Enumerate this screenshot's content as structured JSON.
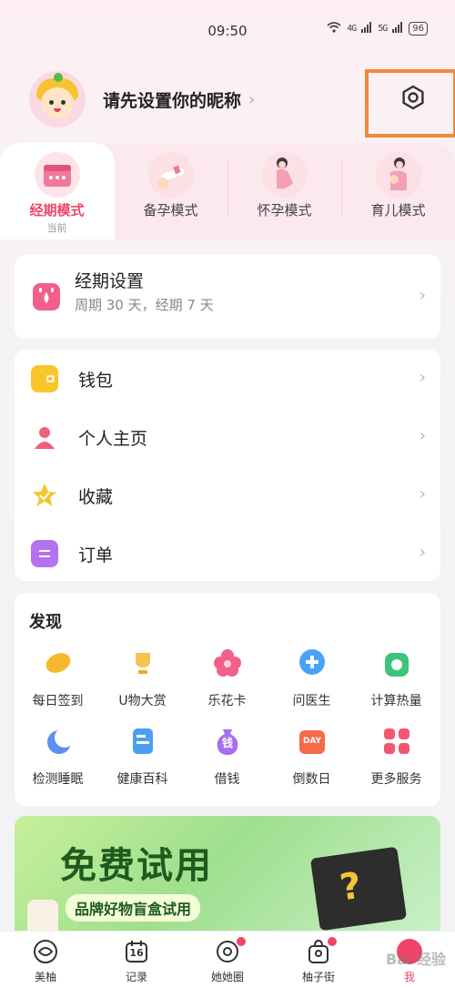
{
  "status": {
    "time": "09:50",
    "net1": "4G",
    "net2": "5G",
    "battery": "96"
  },
  "profile": {
    "nickname": "请先设置你的昵称",
    "chevron": "›"
  },
  "modes": [
    {
      "label": "经期模式",
      "sub": "当前",
      "active": true
    },
    {
      "label": "备孕模式"
    },
    {
      "label": "怀孕模式"
    },
    {
      "label": "育儿模式"
    }
  ],
  "period": {
    "title": "经期设置",
    "subtitle": "周期 30 天，经期 7 天"
  },
  "menu": [
    {
      "label": "钱包",
      "icon": "wallet-icon"
    },
    {
      "label": "个人主页",
      "icon": "person-icon"
    },
    {
      "label": "收藏",
      "icon": "star-icon"
    },
    {
      "label": "订单",
      "icon": "order-icon"
    }
  ],
  "discover": {
    "title": "发现",
    "items": [
      {
        "label": "每日签到",
        "icon": "bean-icon",
        "color": "#f7b92c"
      },
      {
        "label": "U物大赏",
        "icon": "trophy-icon",
        "color": "#f5c24b"
      },
      {
        "label": "乐花卡",
        "icon": "flower-icon",
        "color": "#f25f8b"
      },
      {
        "label": "问医生",
        "icon": "medical-chat-icon",
        "color": "#4aa3f2"
      },
      {
        "label": "计算热量",
        "icon": "apple-icon",
        "color": "#3cc47a"
      },
      {
        "label": "检测睡眠",
        "icon": "moon-icon",
        "color": "#5b8ff0"
      },
      {
        "label": "健康百科",
        "icon": "book-icon",
        "color": "#4a9ff5"
      },
      {
        "label": "借钱",
        "icon": "money-bag-icon",
        "color": "#a66ff0",
        "text": "钱"
      },
      {
        "label": "倒数日",
        "icon": "calendar-day-icon",
        "color": "#f56b4a",
        "text": "DAY"
      },
      {
        "label": "更多服务",
        "icon": "grid-icon",
        "color": "#f2576f"
      }
    ]
  },
  "banner": {
    "title": "免费试用",
    "subtitle": "品牌好物盲盒试用",
    "question": "?"
  },
  "nav": [
    {
      "label": "美柚",
      "icon": "home-icon"
    },
    {
      "label": "记录",
      "icon": "calendar-icon",
      "num": "16"
    },
    {
      "label": "她她圈",
      "icon": "community-icon",
      "dot": true
    },
    {
      "label": "柚子街",
      "icon": "shop-icon",
      "dot": true
    },
    {
      "label": "我",
      "icon": "me-icon",
      "active": true
    }
  ],
  "watermark": "Bai 经验",
  "colors": {
    "accent": "#f0446b",
    "highlight": "#f08a3b"
  }
}
